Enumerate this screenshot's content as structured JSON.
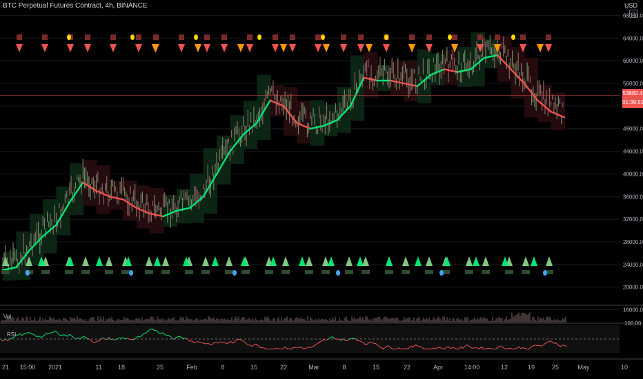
{
  "header": {
    "title": "BTC Perpetual Futures Contract, 4h, BINANCE",
    "currency": "USD"
  },
  "price_badge": {
    "price": "53882.4",
    "countdown": "01:39:51"
  },
  "volume_pane": {
    "label": "Vol"
  },
  "rsi_pane": {
    "label": "RSI",
    "axis_tick": "100.00"
  },
  "colors": {
    "up_trend": "#00e676",
    "down_trend": "#ef5350",
    "buy_marker": "#81c784",
    "buy_strong": "#00e676",
    "sell_marker": "#ef5350",
    "sell_alt": "#ff9800",
    "dot_yellow": "#ffd600",
    "dot_blue": "#42a5f5"
  },
  "chart_data": {
    "type": "line",
    "title": "BTC Perpetual Futures Contract, 4h, BINANCE",
    "y_axis": {
      "scale": "linear",
      "range": [
        14000,
        70000
      ],
      "ticks": [
        "68000.0",
        "64000.0",
        "60000.0",
        "56000.0",
        "52000.0",
        "48000.0",
        "44000.0",
        "40000.0",
        "36000.0",
        "32000.0",
        "28000.0",
        "24000.0",
        "20000.0",
        "16000.0"
      ]
    },
    "x_axis": {
      "tick_labels": [
        "21",
        "15:00",
        "2021",
        "11",
        "18",
        "25",
        "Feb",
        "8",
        "15",
        "22",
        "Mar",
        "8",
        "15",
        "22",
        "Apr",
        "14:00",
        "12",
        "19",
        "25",
        "May",
        "10"
      ]
    },
    "last_price": 53882.4,
    "series": [
      {
        "name": "",
        "values": [
          {
            "x": "Dec 21",
            "y": 23000
          },
          {
            "x": "Dec 24",
            "y": 23500
          },
          {
            "x": "Dec 28",
            "y": 26500
          },
          {
            "x": "Jan 1",
            "y": 29000
          },
          {
            "x": "Jan 4",
            "y": 31000
          },
          {
            "x": "Jan 7",
            "y": 35000
          },
          {
            "x": "Jan 10",
            "y": 38500
          },
          {
            "x": "Jan 12",
            "y": 37000
          },
          {
            "x": "Jan 14",
            "y": 36000
          },
          {
            "x": "Jan 18",
            "y": 35500
          },
          {
            "x": "Jan 21",
            "y": 34000
          },
          {
            "x": "Jan 24",
            "y": 33000
          },
          {
            "x": "Jan 27",
            "y": 32500
          },
          {
            "x": "Jan 30",
            "y": 33500
          },
          {
            "x": "Feb 2",
            "y": 34000
          },
          {
            "x": "Feb 5",
            "y": 36000
          },
          {
            "x": "Feb 8",
            "y": 40000
          },
          {
            "x": "Feb 10",
            "y": 44000
          },
          {
            "x": "Feb 13",
            "y": 47000
          },
          {
            "x": "Feb 17",
            "y": 49000
          },
          {
            "x": "Feb 21",
            "y": 53000
          },
          {
            "x": "Feb 24",
            "y": 52000
          },
          {
            "x": "Feb 27",
            "y": 49000
          },
          {
            "x": "Mar 2",
            "y": 48000
          },
          {
            "x": "Mar 5",
            "y": 48500
          },
          {
            "x": "Mar 8",
            "y": 49500
          },
          {
            "x": "Mar 11",
            "y": 52000
          },
          {
            "x": "Mar 14",
            "y": 57000
          },
          {
            "x": "Mar 17",
            "y": 56500
          },
          {
            "x": "Mar 20",
            "y": 56500
          },
          {
            "x": "Mar 23",
            "y": 56000
          },
          {
            "x": "Mar 27",
            "y": 55500
          },
          {
            "x": "Mar 31",
            "y": 57500
          },
          {
            "x": "Apr 3",
            "y": 58500
          },
          {
            "x": "Apr 6",
            "y": 58000
          },
          {
            "x": "Apr 9",
            "y": 58500
          },
          {
            "x": "Apr 12",
            "y": 60500
          },
          {
            "x": "Apr 14",
            "y": 61000
          },
          {
            "x": "Apr 17",
            "y": 58500
          },
          {
            "x": "Apr 20",
            "y": 56000
          },
          {
            "x": "Apr 23",
            "y": 53000
          },
          {
            "x": "Apr 25",
            "y": 51000
          },
          {
            "x": "Apr 27",
            "y": 50000
          }
        ]
      }
    ],
    "rsi": {
      "axis_range": [
        0,
        100
      ]
    },
    "marker_counts": {
      "top_triangles_red": 24,
      "top_triangles_orange": 10,
      "top_dots": 8,
      "bottom_triangles_light": 28,
      "bottom_triangles_bright": 18,
      "bottom_dots": 6
    }
  }
}
